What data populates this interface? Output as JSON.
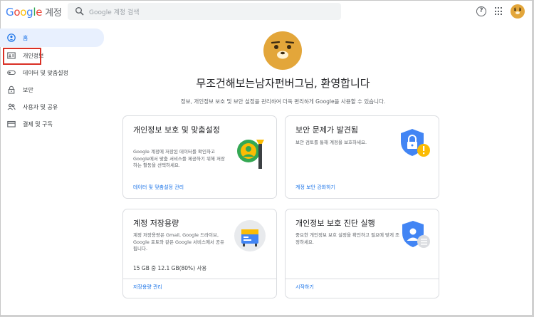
{
  "header": {
    "logo_letters": [
      "G",
      "o",
      "o",
      "g",
      "l",
      "e"
    ],
    "logo_suffix": "계정",
    "search_placeholder": "Google 계정 검색",
    "help_icon": "help-circle-icon",
    "apps_icon": "apps-grid-icon"
  },
  "sidebar": {
    "items": [
      {
        "label": "홈",
        "icon": "home-icon"
      },
      {
        "label": "개인정보",
        "icon": "id-card-icon"
      },
      {
        "label": "데이터 및 맞춤설정",
        "icon": "toggle-icon"
      },
      {
        "label": "보안",
        "icon": "lock-icon"
      },
      {
        "label": "사용자 및 공유",
        "icon": "people-icon"
      },
      {
        "label": "결제 및 구독",
        "icon": "credit-card-icon"
      }
    ]
  },
  "main": {
    "welcome": "무조건해보는남자펀버그님, 환영합니다",
    "subtitle": "정보, 개인정보 보호 및 보안 설정을 관리하여 더욱 편리하게 Google을 사용할 수 있습니다.",
    "cards": [
      {
        "title": "개인정보 보호 및 맞춤설정",
        "desc": "Google 계정에 저장된 데이터를 확인하고 Google에서 맞춤 서비스를 제공하기 위해 저장하는 활동을 선택하세요.",
        "link": "데이터 및 맞춤설정 관리"
      },
      {
        "title": "보안 문제가 발견됨",
        "desc": "보안 검토를 통해 계정을 보호하세요.",
        "link": "계정 보안 강화하기"
      },
      {
        "title": "계정 저장용량",
        "desc": "계정 저장용량은 Gmail, Google 드라이브, Google 포토와 같은 Google 서비스에서 공유됩니다.",
        "usage": "15 GB 중 12.1 GB(80%) 사용",
        "link": "저장용량 관리"
      },
      {
        "title": "개인정보 보호 진단 실행",
        "desc": "중요한 개인정보 보호 설정을 확인하고 필요에 맞게 조정하세요.",
        "link": "시작하기"
      }
    ]
  },
  "colors": {
    "accent": "#1a73e8",
    "active_nav_bg": "#e8f0fe",
    "warning": "#fbbc04",
    "shield_blue": "#4285f4",
    "highlight_box": "#d93025",
    "avatar": "#e3a63a"
  }
}
